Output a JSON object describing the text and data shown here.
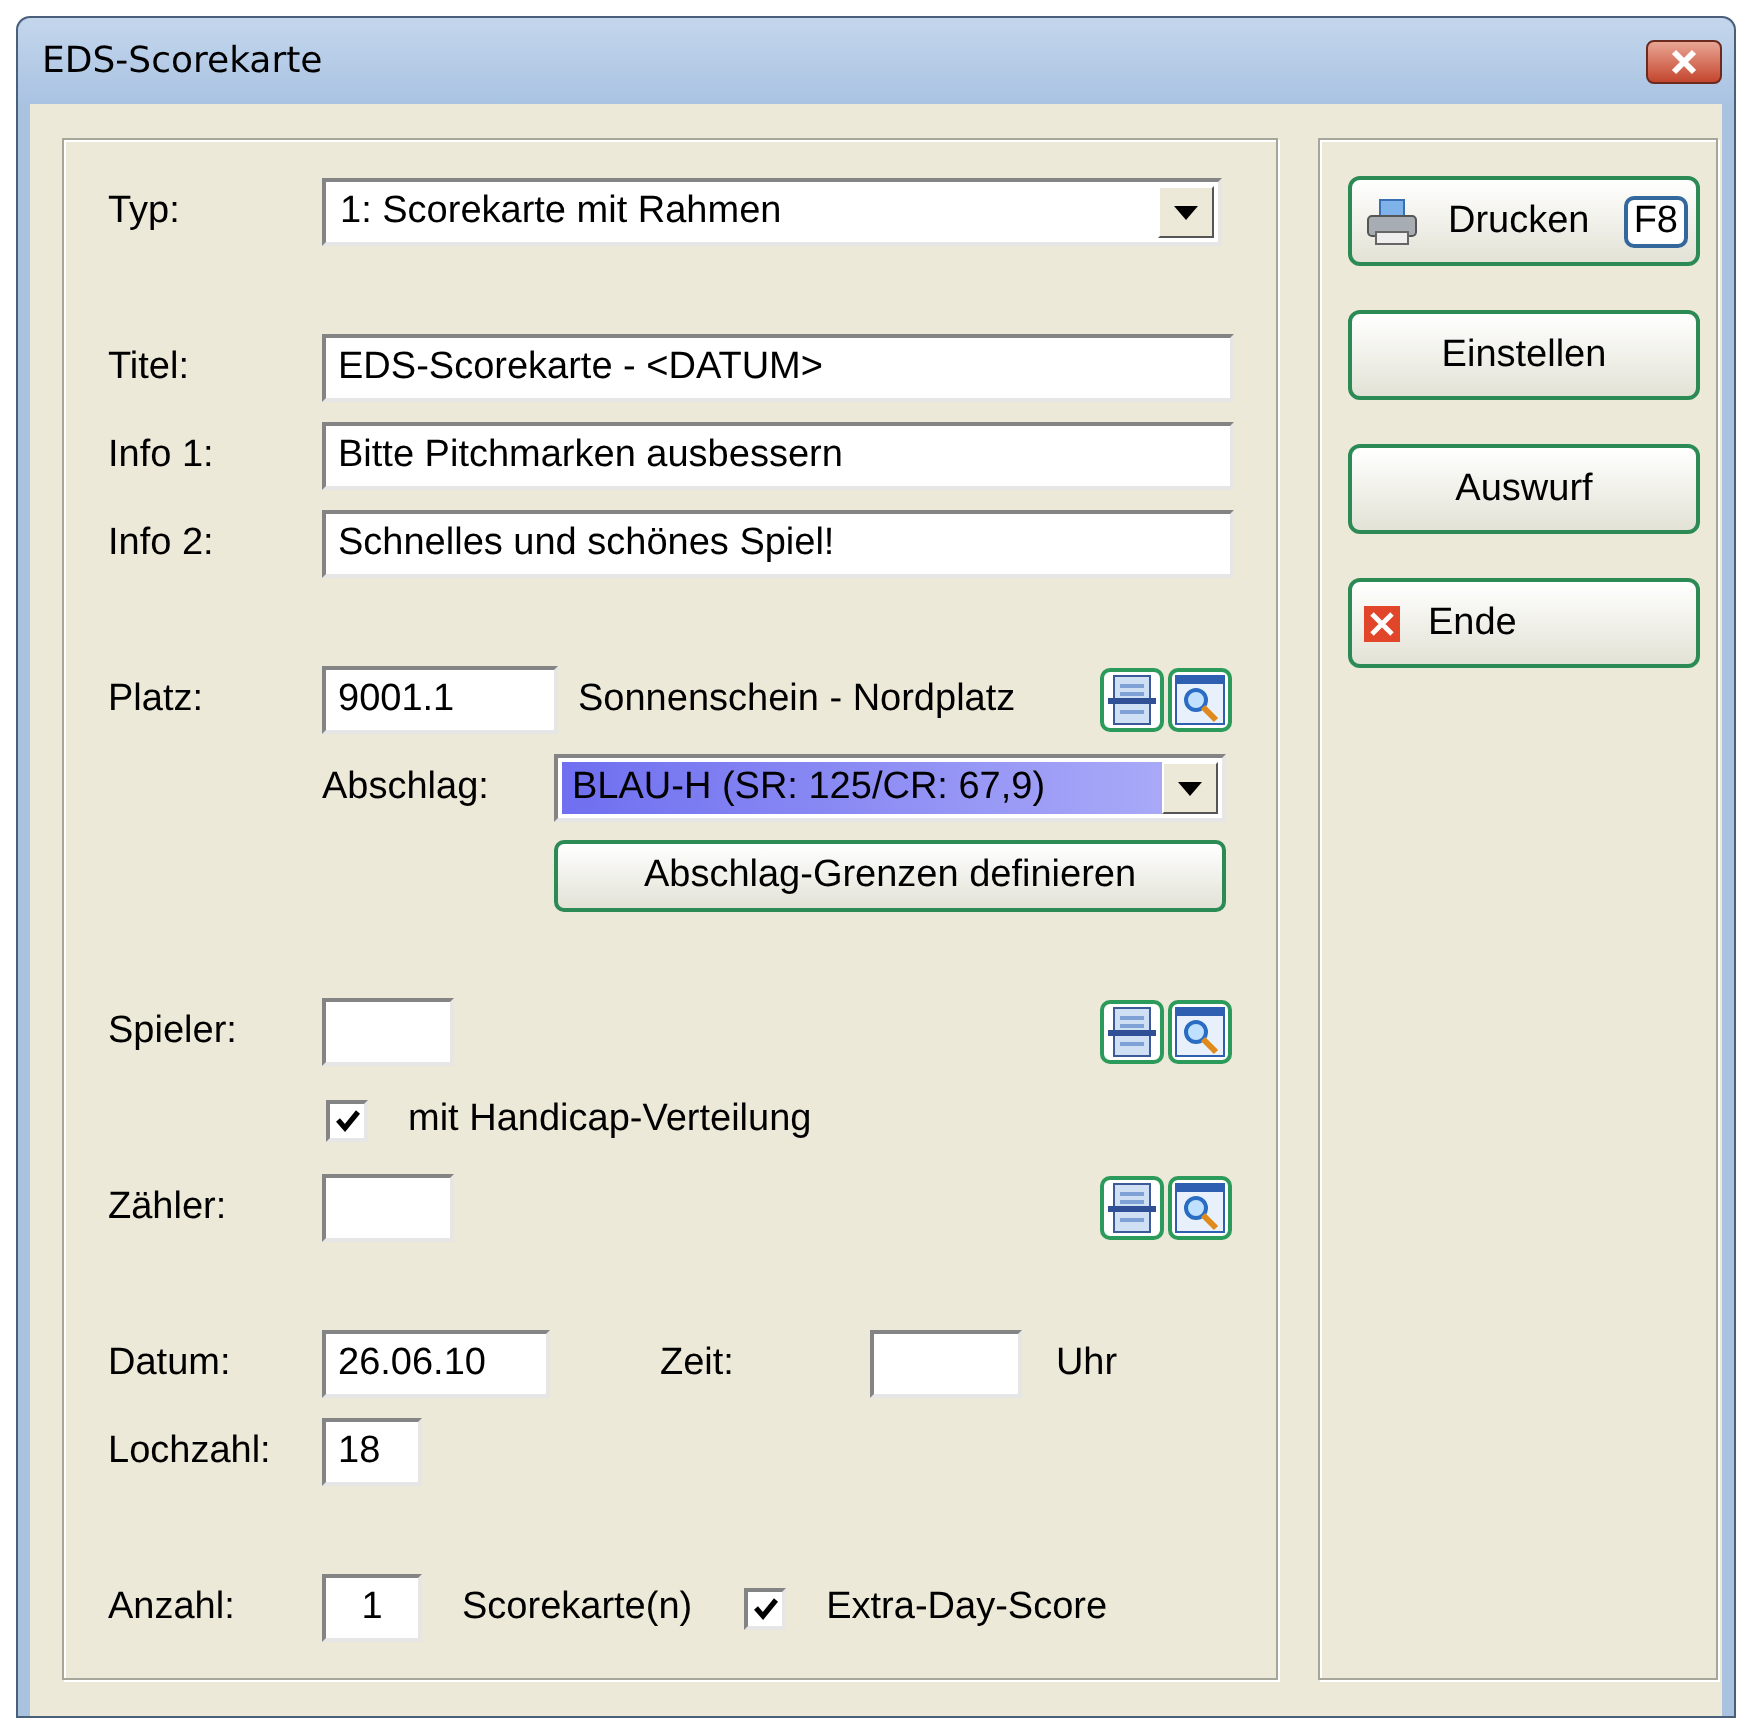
{
  "window": {
    "title": "EDS-Scorekarte"
  },
  "form": {
    "typ": {
      "label": "Typ:",
      "value": "1: Scorekarte mit Rahmen"
    },
    "titel": {
      "label": "Titel:",
      "value": "EDS-Scorekarte - <DATUM>"
    },
    "info_1": {
      "label": "Info 1:",
      "value": "Bitte Pitchmarken ausbessern"
    },
    "info_2": {
      "label": "Info 2:",
      "value": "Schnelles und schönes Spiel!"
    },
    "platz": {
      "label": "Platz:",
      "value": "9001.1",
      "name": "Sonnenschein - Nordplatz"
    },
    "abschlag": {
      "label": "Abschlag:",
      "value": "BLAU-H (SR: 125/CR: 67,9)"
    },
    "grenzen_button": {
      "label": "Abschlag-Grenzen definieren"
    },
    "spieler": {
      "label": "Spieler:"
    },
    "handicap": {
      "label": "mit Handicap-Verteilung",
      "checked": true
    },
    "zaehler": {
      "label": "Zähler:"
    },
    "datum": {
      "label": "Datum:",
      "value": "26.06.10"
    },
    "zeit": {
      "label": "Zeit:",
      "unit": "Uhr"
    },
    "lochzahl": {
      "label": "Lochzahl:",
      "value": "18"
    },
    "anzahl": {
      "label": "Anzahl:",
      "value": "1",
      "unit": "Scorekarte(n)"
    },
    "extra_day_score": {
      "label": "Extra-Day-Score",
      "checked": true
    }
  },
  "buttons": [
    {
      "label": "Drucken",
      "kind": "print",
      "shortcut": "F8"
    },
    {
      "label": "Einstellen",
      "kind": "plain"
    },
    {
      "label": "Auswurf",
      "kind": "plain"
    },
    {
      "label": "Ende",
      "kind": "exit"
    }
  ]
}
